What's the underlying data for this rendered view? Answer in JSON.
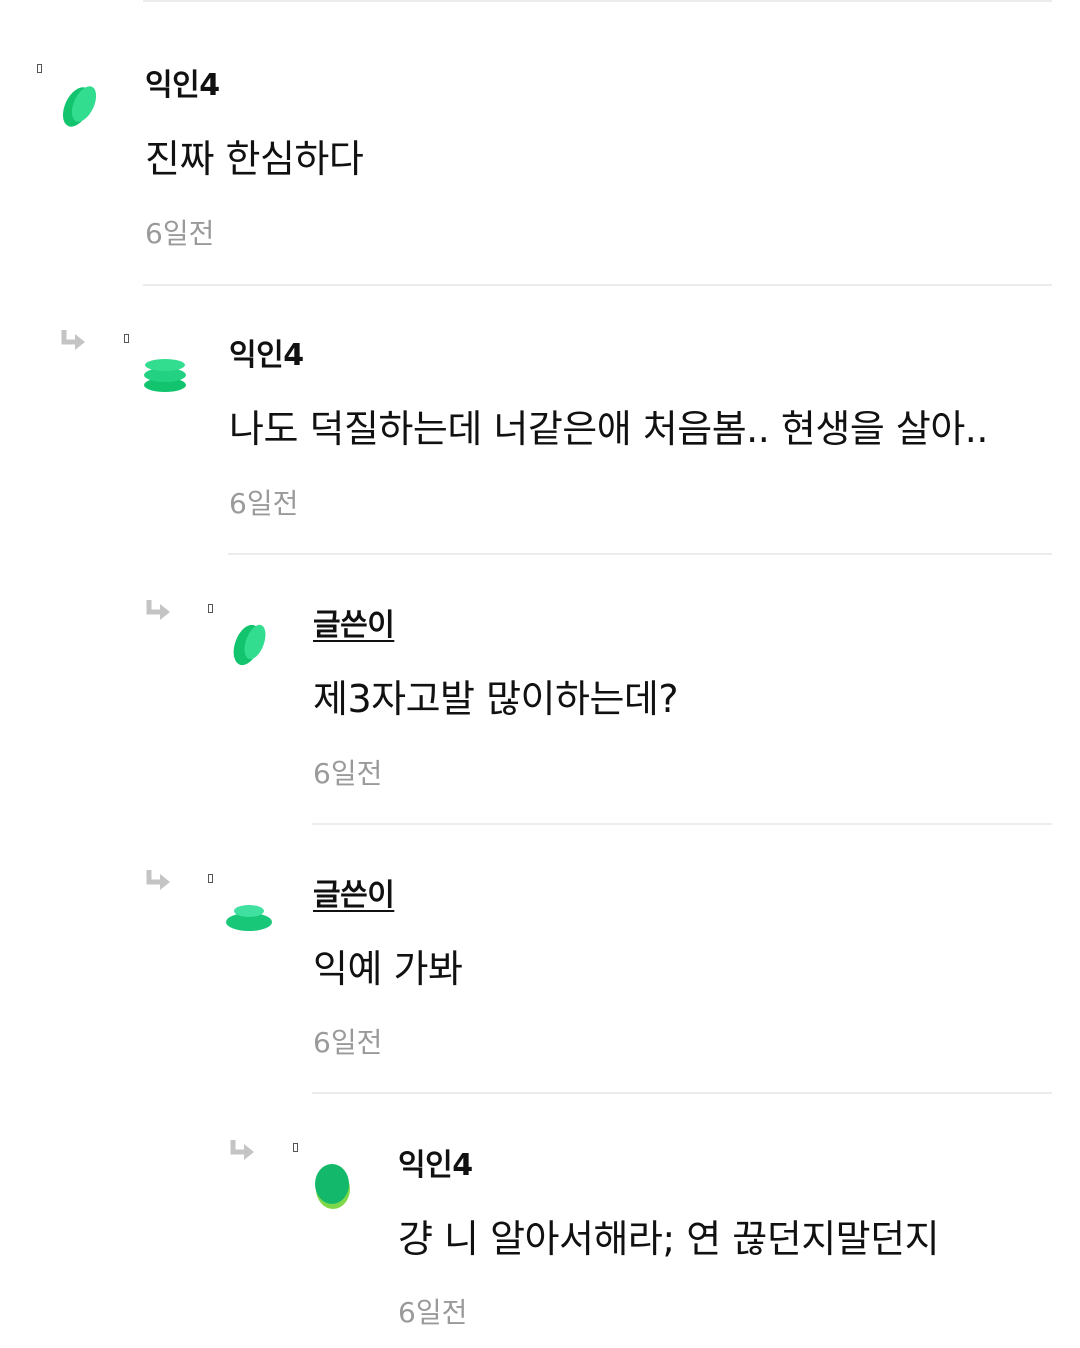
{
  "comments": [
    {
      "author": "익인4",
      "text": "진짜 한심하다",
      "time": "6일전"
    },
    {
      "author": "익인4",
      "text": "나도 덕질하는데 너같은애 처음봄.. 현생을 살아..",
      "time": "6일전"
    },
    {
      "author": "글쓴이",
      "text": "제3자고발 많이하는데?",
      "time": "6일전"
    },
    {
      "author": "글쓴이",
      "text": "익예 가봐",
      "time": "6일전"
    },
    {
      "author": "익인4",
      "text": "걍 니 알아서해라; 연 끊던지말던지",
      "time": "6일전"
    }
  ],
  "icons": {
    "reply": "reply-arrow-icon",
    "avatar": "leaf-avatar-icon",
    "marker": "rank-marker-icon"
  },
  "colors": {
    "accent_green": "#1fcf7a",
    "text": "#111111",
    "muted": "#9a9a9a",
    "divider": "#ececec",
    "arrow": "#c4c4c4"
  }
}
